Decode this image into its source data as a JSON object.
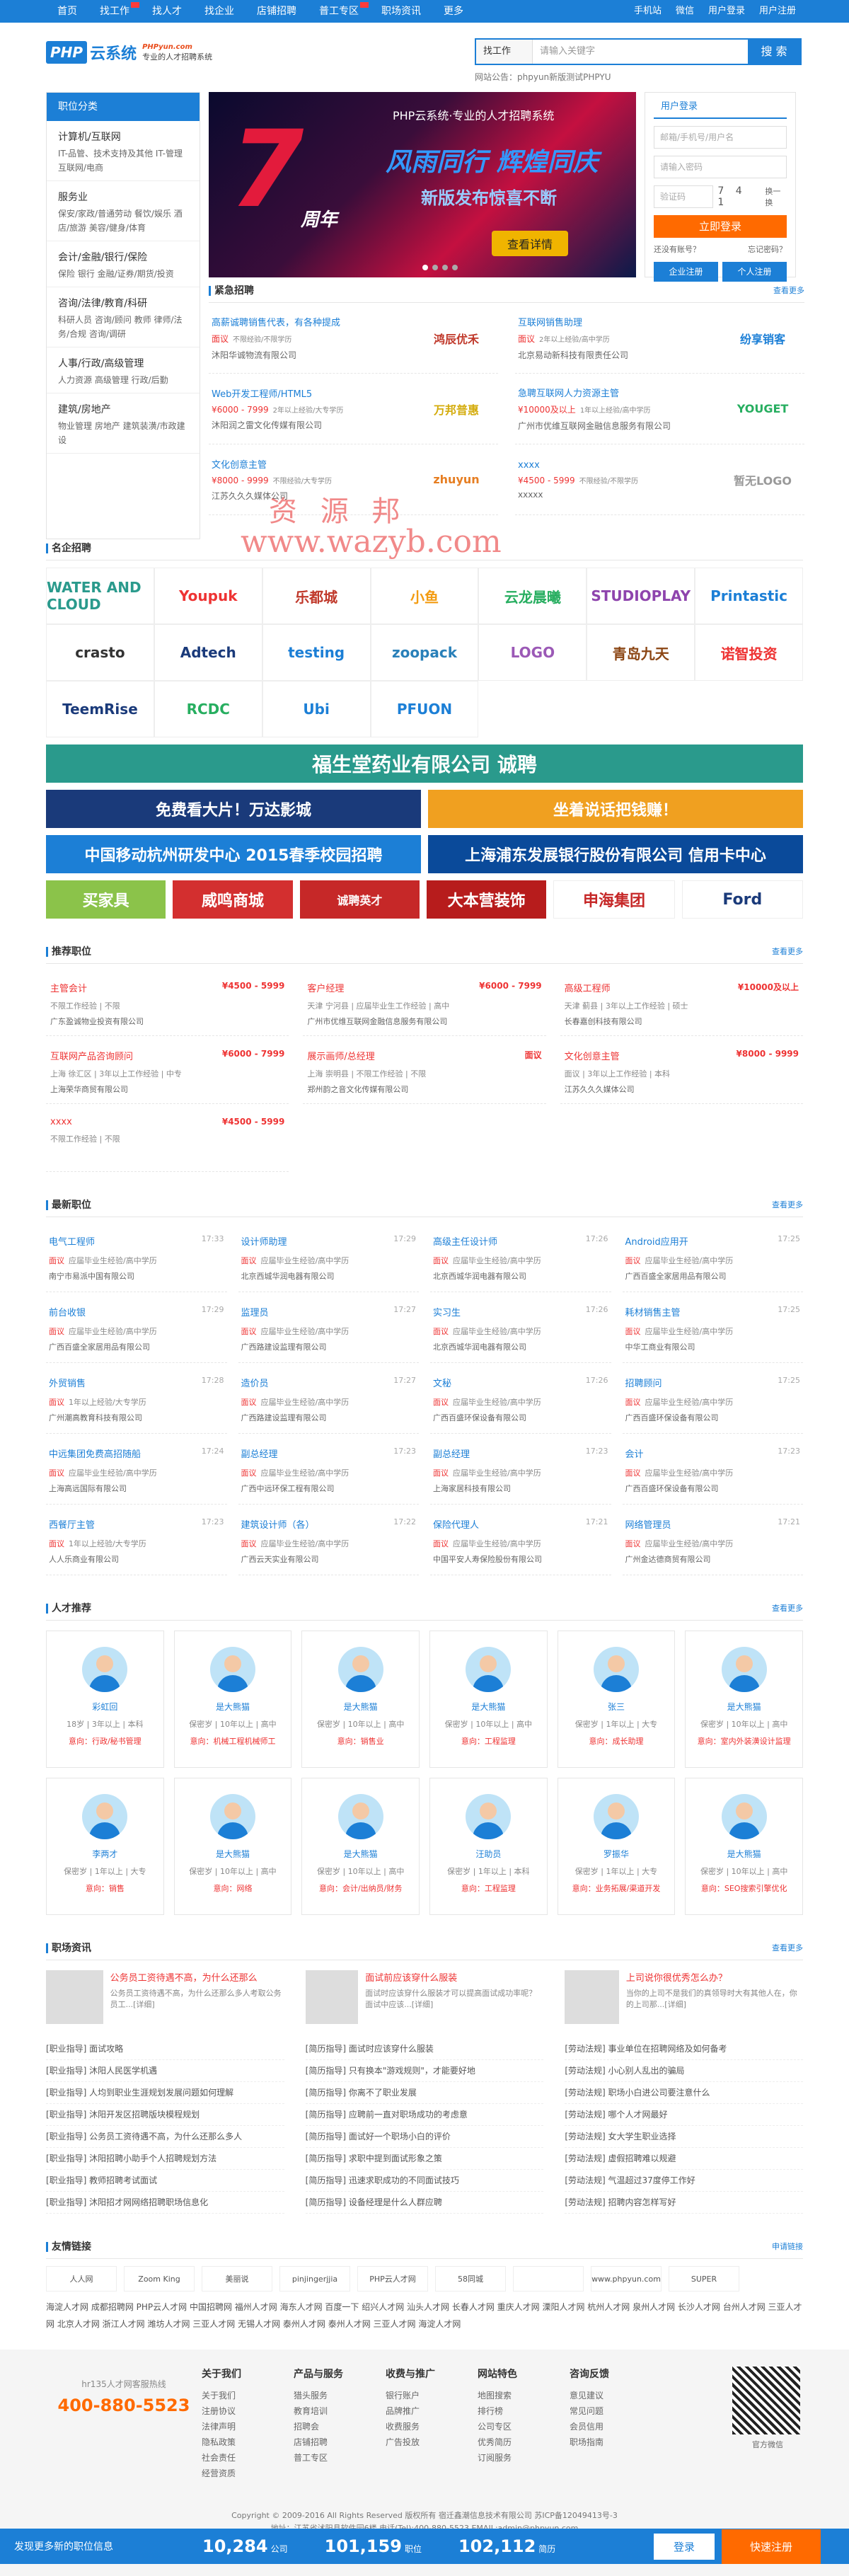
{
  "topnav": {
    "items": [
      "首页",
      "找工作",
      "找人才",
      "找企业",
      "店铺招聘",
      "普工专区",
      "职场资讯",
      "更多"
    ],
    "right": [
      "手机站",
      "微信",
      "用户登录",
      "用户注册"
    ]
  },
  "header": {
    "logo_php": "PHP",
    "logo_yun": "云系统",
    "logo_url": "PHPyun.com",
    "logo_slogan": "专业的人才招聘系统",
    "search_type": "找工作",
    "search_placeholder": "请输入关键字",
    "search_button": "搜 索",
    "hotwords": "网站公告：phpyun新版测试PHPYU"
  },
  "catmenu": {
    "title": "职位分类",
    "groups": [
      {
        "title": "计算机/互联网",
        "sub": "IT-品管、技术支持及其他  IT-管理  互联网/电商"
      },
      {
        "title": "服务业",
        "sub": "保安/家政/普通劳动  餐饮/娱乐  酒店/旅游  美容/健身/体育"
      },
      {
        "title": "会计/金融/银行/保险",
        "sub": "保险  银行  金融/证券/期货/投资"
      },
      {
        "title": "咨询/法律/教育/科研",
        "sub": "科研人员  咨询/顾问  教师  律师/法务/合规  咨询/调研"
      },
      {
        "title": "人事/行政/高级管理",
        "sub": "人力资源  高级管理  行政/后勤"
      },
      {
        "title": "建筑/房地产",
        "sub": "物业管理  房地产  建筑装潢/市政建设"
      }
    ]
  },
  "banner": {
    "seven": "7",
    "zhou": "周年",
    "line1": "PHP云系统·专业的人才招聘系统",
    "line2": "风雨同行 辉煌同庆",
    "line3": "新版发布惊喜不断",
    "button": "查看详情"
  },
  "login": {
    "tab1": "用户登录",
    "tab2": "",
    "user_placeholder": "邮箱/手机号/用户名",
    "pass_placeholder": "请输入密码",
    "code_placeholder": "验证码",
    "code_value": "7 4 1",
    "refresh": "换一换",
    "login_button": "立即登录",
    "remember": "还没有账号？",
    "forgot": "忘记密码？",
    "reg_company": "企业注册",
    "reg_person": "个人注册"
  },
  "urgent": {
    "title": "紧急招聘",
    "more": "查看更多",
    "items": [
      {
        "job": "高薪诚聘销售代表，有各种提成",
        "salary": "面议",
        "req": "不限经验/不限学历",
        "company": "沐阳华诚物流有限公司",
        "logo": "鸿辰优禾"
      },
      {
        "job": "互联网销售助理",
        "salary": "面议",
        "req": "2年以上经验/高中学历",
        "company": "北京易动新科技有限责任公司",
        "logo": "纷享销客"
      },
      {
        "job": "Web开发工程师/HTML5",
        "salary": "¥6000 - 7999",
        "req": "2年以上经验/大专学历",
        "company": "沐阳润之雷文化传媒有限公司",
        "logo": "万邦普惠"
      },
      {
        "job": "急聘互联网人力资源主管",
        "salary": "¥10000及以上",
        "req": "1年以上经验/高中学历",
        "company": "广州市优维互联网金融信息服务有限公司",
        "logo": "YOUGET"
      },
      {
        "job": "文化创意主管",
        "salary": "¥8000 - 9999",
        "req": "不限经验/大专学历",
        "company": "江苏久久久媒体公司",
        "logo": "zhuyun"
      },
      {
        "job": "xxxx",
        "salary": "¥4500 - 5999",
        "req": "不限经验/不限学历",
        "company": "xxxxx",
        "logo": "暂无LOGO"
      }
    ]
  },
  "famous": {
    "title": "名企招聘",
    "logos": [
      "WATER AND CLOUD",
      "Youpuk",
      "乐都城",
      "小鱼",
      "云龙晨曦",
      "STUDIOPLAY",
      "Printastic",
      "crasto",
      "Adtech",
      "testing",
      "zoopack",
      "LOGO",
      "青岛九天",
      "诺智投资",
      "TeemRise",
      "RCDC",
      "Ubi",
      "PFUON",
      "福生堂"
    ],
    "ads": [
      "福生堂药业有限公司 诚聘",
      "免费看大片！万达影城",
      "坐着说话把钱赚！",
      "中国移动杭州研发中心 2015春季校园招聘",
      "上海浦东发展银行股份有限公司 信用卡中心",
      "买家具",
      "威鸣商城",
      "诚聘英才",
      "大本营装饰",
      "申海集团",
      "Ford"
    ]
  },
  "recommended": {
    "title": "推荐职位",
    "more": "查看更多",
    "items": [
      {
        "job": "主管会计",
        "salary": "¥4500 - 5999",
        "meta": "不限工作经验 | 不限",
        "company": "广东盈诚物业投资有限公司"
      },
      {
        "job": "客户经理",
        "salary": "¥6000 - 7999",
        "meta": "天津 宁河县 | 应届毕业生工作经验 | 高中",
        "company": "广州市优维互联网金融信息服务有限公司"
      },
      {
        "job": "高级工程师",
        "salary": "¥10000及以上",
        "meta": "天津 蓟县 | 3年以上工作经验 | 硕士",
        "company": "长春嘉创科技有限公司"
      },
      {
        "job": "互联网产品咨询顾问",
        "salary": "¥6000 - 7999",
        "meta": "上海 徐汇区 | 3年以上工作经验 | 中专",
        "company": "上海荣华商贸有限公司"
      },
      {
        "job": "展示画师/总经理",
        "salary": "面议",
        "meta": "上海 崇明县 | 不限工作经验 | 不限",
        "company": "郑州韵之音文化传媒有限公司"
      },
      {
        "job": "文化创意主管",
        "salary": "¥8000 - 9999",
        "meta": "面议 | 3年以上工作经验 | 本科",
        "company": "江苏久久久媒体公司"
      },
      {
        "job": "xxxx",
        "salary": "¥4500 - 5999",
        "meta": "不限工作经验 | 不限",
        "company": ""
      }
    ]
  },
  "newest": {
    "title": "最新职位",
    "more": "查看更多",
    "items": [
      {
        "job": "电气工程师",
        "time": "17:33",
        "salary": "面议",
        "meta": "应届毕业生经验/高中学历",
        "company": "南宁市易派中国有限公司"
      },
      {
        "job": "设计师助理",
        "time": "17:29",
        "salary": "面议",
        "meta": "应届毕业生经验/高中学历",
        "company": "北京西城华润电器有限公司"
      },
      {
        "job": "高级主任设计师",
        "time": "17:26",
        "salary": "面议",
        "meta": "应届毕业生经验/高中学历",
        "company": "北京西城华润电器有限公司"
      },
      {
        "job": "Android应用开",
        "time": "17:25",
        "salary": "面议",
        "meta": "应届毕业生经验/高中学历",
        "company": "广西百盛全家居用品有限公司"
      },
      {
        "job": "前台收银",
        "time": "17:29",
        "salary": "面议",
        "meta": "应届毕业生经验/高中学历",
        "company": "广西百盛全家居用品有限公司"
      },
      {
        "job": "监理员",
        "time": "17:27",
        "salary": "面议",
        "meta": "应届毕业生经验/高中学历",
        "company": "广西路建设监理有限公司"
      },
      {
        "job": "实习生",
        "time": "17:26",
        "salary": "面议",
        "meta": "应届毕业生经验/高中学历",
        "company": "北京西城华润电器有限公司"
      },
      {
        "job": "耗材销售主管",
        "time": "17:25",
        "salary": "面议",
        "meta": "应届毕业生经验/高中学历",
        "company": "中华工商业有限公司"
      },
      {
        "job": "外贸销售",
        "time": "17:28",
        "salary": "面议",
        "meta": "1年以上经验/大专学历",
        "company": "广州潮高教育科技有限公司"
      },
      {
        "job": "造价员",
        "time": "17:27",
        "salary": "面议",
        "meta": "应届毕业生经验/高中学历",
        "company": "广西路建设监理有限公司"
      },
      {
        "job": "文秘",
        "time": "17:26",
        "salary": "面议",
        "meta": "应届毕业生经验/高中学历",
        "company": "广西百盛环保设备有限公司"
      },
      {
        "job": "招聘顾问",
        "time": "17:25",
        "salary": "面议",
        "meta": "应届毕业生经验/高中学历",
        "company": "广西百盛环保设备有限公司"
      },
      {
        "job": "中远集团免费高招随船",
        "time": "17:24",
        "salary": "面议",
        "meta": "应届毕业生经验/高中学历",
        "company": "上海高远国际有限公司"
      },
      {
        "job": "副总经理",
        "time": "17:23",
        "salary": "面议",
        "meta": "应届毕业生经验/高中学历",
        "company": "广西中远环保工程有限公司"
      },
      {
        "job": "副总经理",
        "time": "17:23",
        "salary": "面议",
        "meta": "应届毕业生经验/高中学历",
        "company": "上海家居科技有限公司"
      },
      {
        "job": "会计",
        "time": "17:23",
        "salary": "面议",
        "meta": "应届毕业生经验/高中学历",
        "company": "广西百盛环保设备有限公司"
      },
      {
        "job": "西餐厅主管",
        "time": "17:23",
        "salary": "面议",
        "meta": "1年以上经验/大专学历",
        "company": "人人乐商业有限公司"
      },
      {
        "job": "建筑设计师（各）",
        "time": "17:22",
        "salary": "面议",
        "meta": "应届毕业生经验/高中学历",
        "company": "广西云天实业有限公司"
      },
      {
        "job": "保险代理人",
        "time": "17:21",
        "salary": "面议",
        "meta": "应届毕业生经验/高中学历",
        "company": "中国平安人寿保险股份有限公司"
      },
      {
        "job": "网络管理员",
        "time": "17:21",
        "salary": "面议",
        "meta": "应届毕业生经验/高中学历",
        "company": "广州金达德商贸有限公司"
      }
    ]
  },
  "talents": {
    "title": "人才推荐",
    "more": "查看更多",
    "items": [
      {
        "name": "彩虹回",
        "info": "18岁 | 3年以上 | 本科",
        "want": "意向：行政/秘书管理"
      },
      {
        "name": "是大熊猫",
        "info": "保密岁 | 10年以上 | 高中",
        "want": "意向：机械工程机械师工"
      },
      {
        "name": "是大熊猫",
        "info": "保密岁 | 10年以上 | 高中",
        "want": "意向：销售业"
      },
      {
        "name": "是大熊猫",
        "info": "保密岁 | 10年以上 | 高中",
        "want": "意向：工程监理"
      },
      {
        "name": "张三",
        "info": "保密岁 | 1年以上 | 大专",
        "want": "意向：成长助理"
      },
      {
        "name": "是大熊猫",
        "info": "保密岁 | 10年以上 | 高中",
        "want": "意向：室内外装潢设计监理"
      },
      {
        "name": "李两才",
        "info": "保密岁 | 1年以上 | 大专",
        "want": "意向：销售"
      },
      {
        "name": "是大熊猫",
        "info": "保密岁 | 10年以上 | 高中",
        "want": "意向：网络"
      },
      {
        "name": "是大熊猫",
        "info": "保密岁 | 10年以上 | 高中",
        "want": "意向：会计/出纳员/财务"
      },
      {
        "name": "汪助员",
        "info": "保密岁 | 1年以上 | 本科",
        "want": "意向：工程监理"
      },
      {
        "name": "罗振华",
        "info": "保密岁 | 1年以上 | 大专",
        "want": "意向：业务拓展/渠道开发"
      },
      {
        "name": "是大熊猫",
        "info": "保密岁 | 10年以上 | 高中",
        "want": "意向：SEO搜索引擎优化"
      }
    ]
  },
  "news": {
    "title": "职场资讯",
    "more": "查看更多",
    "tops": [
      {
        "title": "公务员工资待遇不高，为什么还那么",
        "desc": "公务员工资待遇不高，为什么还那么多人考取公务员工...[详细]"
      },
      {
        "title": "面试前应该穿什么服装",
        "desc": "面试时应该穿什么服装才可以提高面试成功率呢？面试中应该...[详细]"
      },
      {
        "title": "上司说你很优秀怎么办？",
        "desc": "当你的上司不是我们的真领导时大有其他人在，你的上司那...[详细]"
      }
    ],
    "cols": [
      [
        "[职业指导] 面试攻略",
        "[职业指导] 沐阳人民医学机遇",
        "[职业指导] 人均到职业生涯规划发展问题如何理解",
        "[职业指导] 沐阳开发区招聘版块模程规划",
        "[职业指导] 公务员工资待遇不高，为什么还那么多人",
        "[职业指导] 沐阳招聘小助手个人招聘规划方法",
        "[职业指导] 教师招聘考试面试",
        "[职业指导] 沐阳招才网网络招聘职场信息化"
      ],
      [
        "[简历指导] 面试时应该穿什么服装",
        "[简历指导] 只有换本\"游戏规则\"，才能要好地",
        "[简历指导] 你离不了职业发展",
        "[简历指导] 应聘前一直对职场成功的考虑意",
        "[简历指导] 面试好一个职场小白的评价",
        "[简历指导] 求职中提到面试形象之策",
        "[简历指导] 迅速求职成功的不同面试技巧",
        "[简历指导] 设备经理是什么人群应聘"
      ],
      [
        "[劳动法规] 事业单位在招聘网络及如何备考",
        "[劳动法规] 小心别人乱出的骗局",
        "[劳动法规] 职场小白进公司要注意什么",
        "[劳动法规] 哪个人才网最好",
        "[劳动法规] 女大学生职业选择",
        "[劳动法规] 虚假招聘难以规避",
        "[劳动法规] 气温超过37度停工作好",
        "[劳动法规] 招聘内容怎样写好"
      ]
    ]
  },
  "friends": {
    "title": "友情链接",
    "more": "申请链接",
    "logos": [
      "人人网",
      "Zoom King",
      "美丽说",
      "pinjingerjjia",
      "PHP云人才网",
      "58同城",
      "",
      "www.phpyun.com",
      "SUPER"
    ],
    "texts": "海淀人才网  成都招聘网  PHP云人才网  中国招聘网  福州人才网  海东人才网  百度一下  绍兴人才网  汕头人才网  长春人才网  重庆人才网  溧阳人才网  杭州人才网  泉州人才网  长沙人才网  台州人才网  三亚人才网  北京人才网  浙江人才网  潍坊人才网  三亚人才网  无锡人才网  泰州人才网  泰州人才网  三亚人才网  海淀人才网"
  },
  "footer": {
    "hotline_label": "hr135人才网客服热线",
    "hotline": "400-880-5523",
    "cols": [
      {
        "h": "关于我们",
        "items": [
          "关于我们",
          "注册协议",
          "法律声明",
          "隐私政策",
          "社会责任",
          "经营资质"
        ]
      },
      {
        "h": "产品与服务",
        "items": [
          "猎头服务",
          "教育培训",
          "招聘会",
          "店铺招聘",
          "普工专区"
        ]
      },
      {
        "h": "收费与推广",
        "items": [
          "银行账户",
          "品牌推广",
          "收费服务",
          "广告投放"
        ]
      },
      {
        "h": "网站特色",
        "items": [
          "地图搜索",
          "排行榜",
          "公司专区",
          "优秀简历",
          "订阅服务"
        ]
      },
      {
        "h": "咨询反馈",
        "items": [
          "意见建议",
          "常见问题",
          "会员信用",
          "职场指南"
        ]
      }
    ],
    "qr_caption": "官方微信",
    "copyright": "Copyright © 2009-2016 All Rights Reserved 版权所有 宿迁鑫潮信息技术有限公司 苏ICP备12049413号-3",
    "address": "地址：江苏省沭阳县软件园6楼 电话(Tel):400-880-5523 EMAIL:admin@phpyun.com"
  },
  "bottombar": {
    "label": "发现更多新的职位信息",
    "stats": [
      {
        "num": "10,284",
        "unit": "公司"
      },
      {
        "num": "101,159",
        "unit": "职位"
      },
      {
        "num": "102,112",
        "unit": "简历"
      }
    ],
    "login": "登录",
    "register": "快速注册"
  },
  "watermark": {
    "cn": "资 源 邦",
    "url": "www.wazyb.com"
  }
}
